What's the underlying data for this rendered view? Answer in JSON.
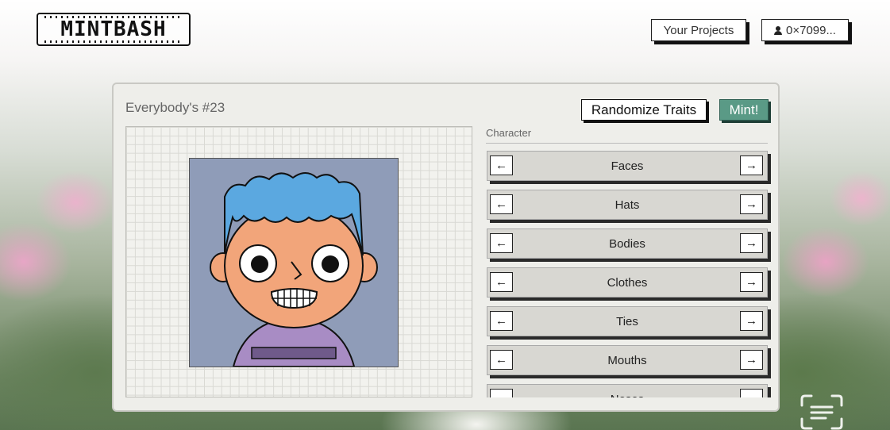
{
  "header": {
    "logo_text": "MINTBASH",
    "projects_label": "Your Projects",
    "wallet_label": "0×7099..."
  },
  "panel": {
    "title": "Everybody's #23",
    "randomize_label": "Randomize Traits",
    "mint_label": "Mint!",
    "section_label": "Character",
    "arrow_left": "←",
    "arrow_right": "→",
    "traits": [
      {
        "label": "Faces"
      },
      {
        "label": "Hats"
      },
      {
        "label": "Bodies"
      },
      {
        "label": "Clothes"
      },
      {
        "label": "Ties"
      },
      {
        "label": "Mouths"
      },
      {
        "label": "Noses"
      }
    ]
  },
  "colors": {
    "mint_accent": "#5a9a86",
    "avatar_background": "#8f9cb8",
    "hair": "#5ba8e0",
    "skin": "#f2a57a",
    "shirt": "#a88cc4"
  }
}
